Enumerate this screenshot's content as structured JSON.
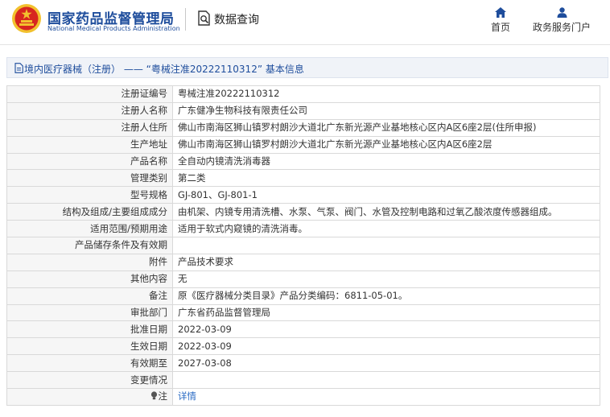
{
  "header": {
    "brand_cn": "国家药品监督管理局",
    "brand_en": "National Medical Products Administration",
    "page_title": "数据查询",
    "nav": [
      {
        "label": "首页",
        "icon": "home-icon"
      },
      {
        "label": "政务服务门户",
        "icon": "user-icon"
      }
    ]
  },
  "breadcrumb": {
    "text": "境内医疗器械（注册） —— “粤械注准20222110312” 基本信息",
    "icon": "document-icon"
  },
  "rows": [
    {
      "label": "注册证编号",
      "value": "粤械注准20222110312"
    },
    {
      "label": "注册人名称",
      "value": "广东健净生物科技有限责任公司"
    },
    {
      "label": "注册人住所",
      "value": "佛山市南海区狮山镇罗村朗沙大道北广东新光源产业基地核心区内A区6座2层(住所申报)"
    },
    {
      "label": "生产地址",
      "value": "佛山市南海区狮山镇罗村朗沙大道北广东新光源产业基地核心区内A区6座2层"
    },
    {
      "label": "产品名称",
      "value": "全自动内镜清洗消毒器"
    },
    {
      "label": "管理类别",
      "value": "第二类"
    },
    {
      "label": "型号规格",
      "value": "GJ-801、GJ-801-1"
    },
    {
      "label": "结构及组成/主要组成成分",
      "value": "由机架、内镜专用清洗槽、水泵、气泵、阀门、水管及控制电路和过氧乙酸浓度传感器组成。"
    },
    {
      "label": "适用范围/预期用途",
      "value": "适用于软式内窥镜的清洗消毒。"
    },
    {
      "label": "产品储存条件及有效期",
      "value": ""
    },
    {
      "label": "附件",
      "value": "产品技术要求"
    },
    {
      "label": "其他内容",
      "value": "无"
    },
    {
      "label": "备注",
      "value": "原《医疗器械分类目录》产品分类编码：6811-05-01。"
    },
    {
      "label": "审批部门",
      "value": "广东省药品监督管理局"
    },
    {
      "label": "批准日期",
      "value": "2022-03-09"
    },
    {
      "label": "生效日期",
      "value": "2022-03-09"
    },
    {
      "label": "有效期至",
      "value": "2027-03-08"
    },
    {
      "label": "变更情况",
      "value": ""
    }
  ],
  "note_row": {
    "label": "注",
    "icon": "lightbulb-icon",
    "link_text": "详情"
  },
  "colors": {
    "brand_blue": "#1e4d9c",
    "link_blue": "#2a6bc4",
    "emblem_red": "#d7261f",
    "emblem_gold": "#f2c12e"
  }
}
